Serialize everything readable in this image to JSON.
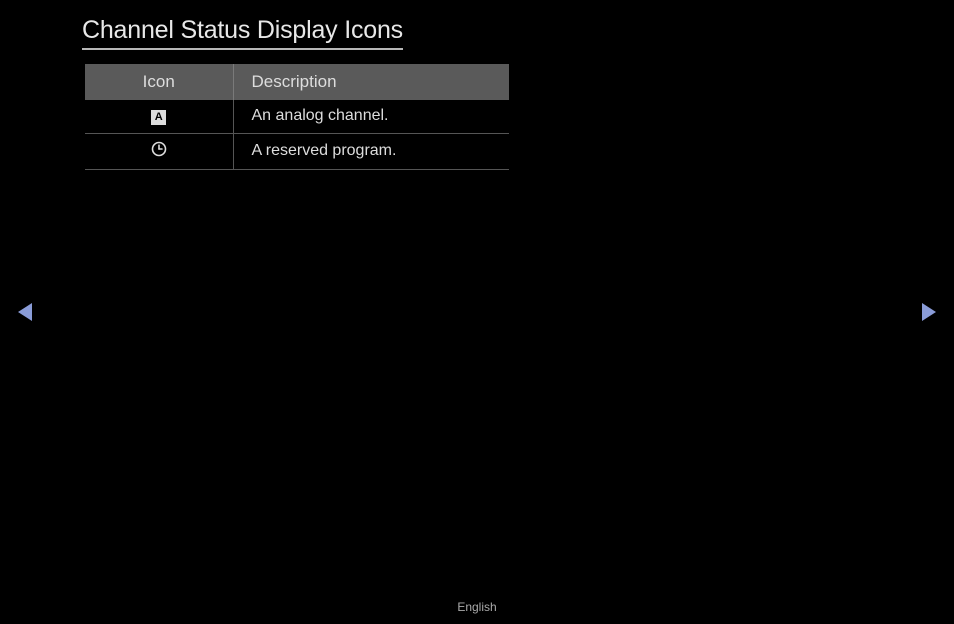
{
  "title": "Channel Status Display Icons",
  "table": {
    "headers": {
      "col1": "Icon",
      "col2": "Description"
    },
    "rows": [
      {
        "icon_type": "analog",
        "icon_label": "A",
        "description": "An analog channel."
      },
      {
        "icon_type": "clock",
        "icon_label": "",
        "description": "A reserved program."
      }
    ]
  },
  "footer": {
    "language": "English"
  },
  "nav": {
    "arrow_color": "#8a9cd8"
  }
}
